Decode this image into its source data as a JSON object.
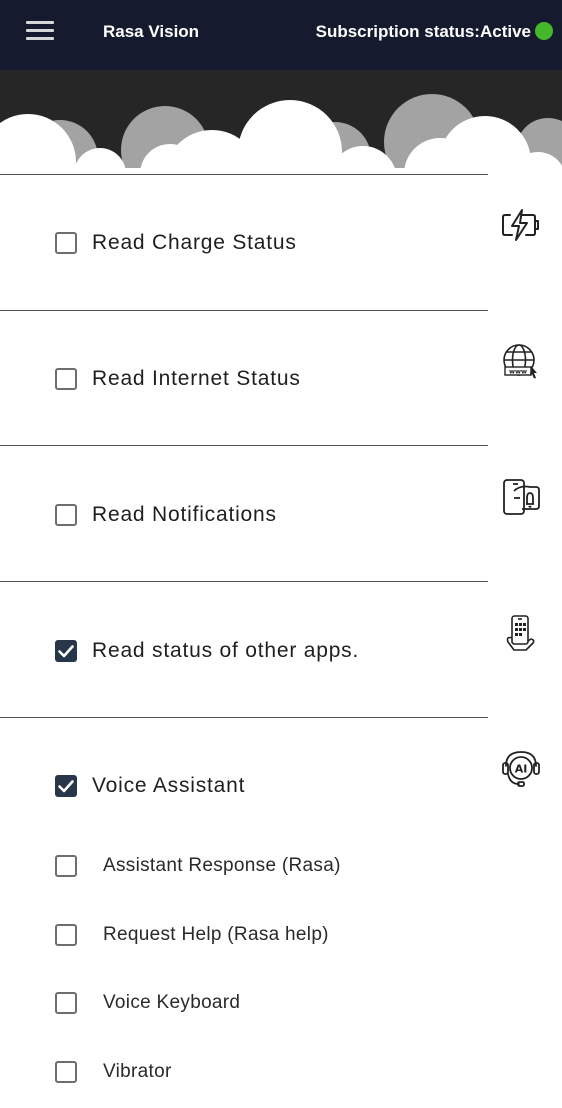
{
  "header": {
    "app_title": "Rasa Vision",
    "subscription_status": "Subscription status:Active",
    "status_color": "#45b72a",
    "background": "#161a2e"
  },
  "permissions": [
    {
      "label": "Read Charge Status",
      "checked": false,
      "icon": "charging-battery-icon"
    },
    {
      "label": "Read Internet Status",
      "checked": false,
      "icon": "globe-www-icon"
    },
    {
      "label": "Read Notifications",
      "checked": false,
      "icon": "phone-notification-bell-icon"
    },
    {
      "label": "Read status of other apps.",
      "checked": true,
      "icon": "hand-holding-phone-apps-icon"
    },
    {
      "label": "Voice Assistant",
      "checked": true,
      "icon": "ai-headset-icon"
    }
  ],
  "voice_assistant_options": [
    {
      "label": "Assistant Response (Rasa)",
      "checked": false
    },
    {
      "label": "Request Help (Rasa help)",
      "checked": false
    },
    {
      "label": "Voice Keyboard",
      "checked": false
    },
    {
      "label": "Vibrator",
      "checked": false
    }
  ],
  "accent_color": "#283649"
}
